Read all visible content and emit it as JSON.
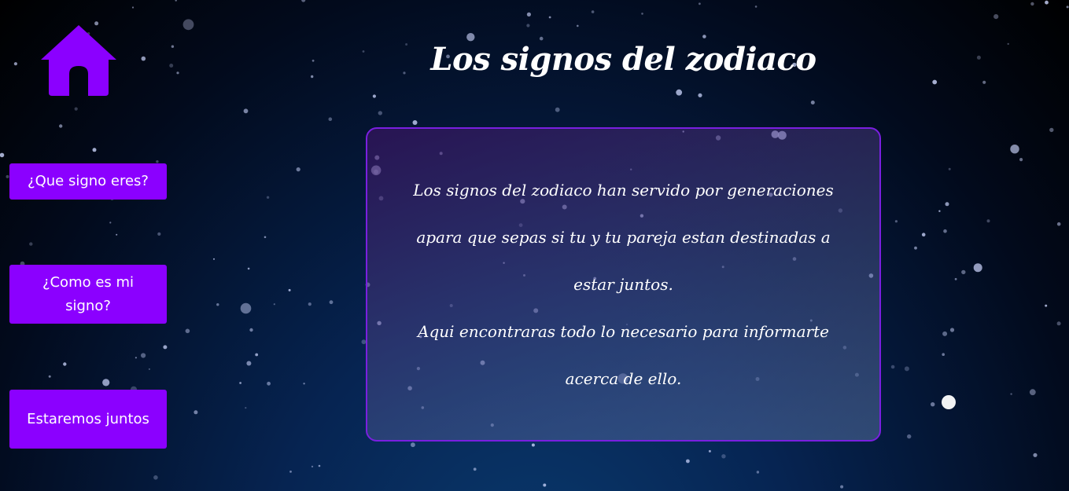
{
  "page": {
    "title": "Los signos del zodiaco"
  },
  "nav": {
    "home_icon": "home-icon",
    "buttons": [
      {
        "label": "¿Que signo eres?"
      },
      {
        "label": "¿Como es mi signo?"
      },
      {
        "label": "Estaremos juntos"
      }
    ]
  },
  "card": {
    "paragraph1": "Los signos del zodiaco han servido por generaciones apara que sepas si tu y tu pareja estan destinadas a estar juntos.",
    "paragraph2": "Aqui encontraras todo lo necesario para informarte acerca de ello."
  },
  "colors": {
    "accent": "#8b00ff",
    "card_border": "#7a1fe0",
    "background_top": "#000000",
    "background_bottom": "#0a3a6e"
  }
}
